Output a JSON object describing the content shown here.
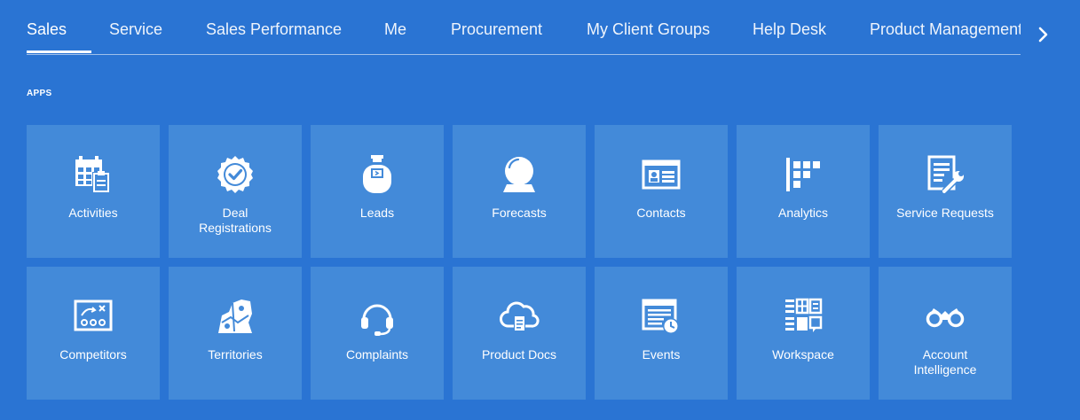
{
  "tabs": [
    {
      "label": "Sales"
    },
    {
      "label": "Service"
    },
    {
      "label": "Sales Performance"
    },
    {
      "label": "Me"
    },
    {
      "label": "Procurement"
    },
    {
      "label": "My Client Groups"
    },
    {
      "label": "Help Desk"
    },
    {
      "label": "Product Management"
    }
  ],
  "active_tab": "Sales",
  "section_label": "APPS",
  "tiles": [
    {
      "label": "Activities",
      "icon": "calendar-clipboard-icon"
    },
    {
      "label": "Deal Registrations",
      "icon": "badge-check-icon"
    },
    {
      "label": "Leads",
      "icon": "jar-icon"
    },
    {
      "label": "Forecasts",
      "icon": "crystal-ball-icon"
    },
    {
      "label": "Contacts",
      "icon": "contact-card-icon"
    },
    {
      "label": "Analytics",
      "icon": "analytics-bars-icon"
    },
    {
      "label": "Service Requests",
      "icon": "document-wrench-icon"
    },
    {
      "label": "Competitors",
      "icon": "strategy-board-icon"
    },
    {
      "label": "Territories",
      "icon": "map-icon"
    },
    {
      "label": "Complaints",
      "icon": "headset-icon"
    },
    {
      "label": "Product Docs",
      "icon": "cloud-document-icon"
    },
    {
      "label": "Events",
      "icon": "calendar-clock-icon"
    },
    {
      "label": "Workspace",
      "icon": "workspace-grid-icon"
    },
    {
      "label": "Account Intelligence",
      "icon": "binoculars-icon"
    }
  ],
  "colors": {
    "background": "#2a74d3",
    "tile": "#438ad9",
    "text": "#ffffff"
  }
}
